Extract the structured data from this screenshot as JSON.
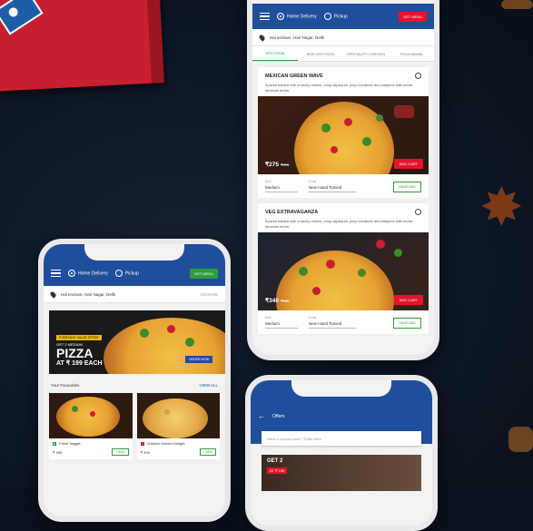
{
  "colors": {
    "brand_blue": "#1f4e9c",
    "brand_red": "#e4142c",
    "veg_green": "#2e9e3a",
    "background": "#0b1320"
  },
  "decor": {
    "box_icon": "pizza-box-icon",
    "spice_icon": "star-anise-icon"
  },
  "phone_menu": {
    "delivery_options": [
      "Home Delivery",
      "Pickup"
    ],
    "selected_delivery": "Home Delivery",
    "action_button": "GET MENU",
    "address": "Hal enclave, Hari Nagar, Delhi",
    "tabs": [
      "VEG PIZZA",
      "NON-VEG PIZZA",
      "SPECIALITY CHICKEN",
      "PIZZA MANIA"
    ],
    "active_tab": "VEG PIZZA",
    "items": [
      {
        "name": "MEXICAN GREEN WAVE",
        "description": "A pizza loaded with crunchy onions, crisp capsicum, juicy tomatoes and jalapeno with exotic Mexican herbs.",
        "price": "₹275",
        "old_price": "₹395",
        "add_label": "ADD CART",
        "size_label": "Size",
        "size_value": "Medium",
        "crust_label": "Crust",
        "crust_value": "New Hand Tossed",
        "add_veg_label": "SAVE ADD"
      },
      {
        "name": "VEG EXTRAVAGANZA",
        "description": "A pizza loaded with crunchy onions, crisp capsicum, juicy tomatoes and jalapeno with exotic Mexican herbs.",
        "price": "₹340",
        "old_price": "₹435",
        "add_label": "ADD CART",
        "size_label": "Size",
        "size_value": "Medium",
        "crust_label": "Crust",
        "crust_value": "New Hand Tossed",
        "add_veg_label": "SAVE ADD"
      }
    ]
  },
  "phone_home": {
    "delivery_options": [
      "Home Delivery",
      "Pickup"
    ],
    "action_button": "GET MENU",
    "address": "Hal enclave, Hari Nagar, Delhi",
    "address_action": "CHANGE",
    "banner": {
      "tag": "EVERYDAY VALUE OFFER",
      "get": "GET 2",
      "medium": "MEDIUM",
      "headline": "PIZZA",
      "price_line": "AT ₹ 199 EACH",
      "cta": "ORDER NOW"
    },
    "favourites_title": "Your Favourites",
    "view_all": "VIEW ALL",
    "favourites": [
      {
        "name": "Fresh Veggie",
        "price": "₹ 395",
        "add": "+ ADD",
        "type": "veg"
      },
      {
        "name": "Chicken Golden Delight",
        "price": "₹ 395",
        "add": "+ ADD",
        "type": "nonveg"
      }
    ]
  },
  "phone_offers": {
    "title": "Offers",
    "coupon_placeholder": "Have a coupon code ? Enter here",
    "offer_get": "GET 2",
    "offer_tag": "AT ₹ 199"
  }
}
